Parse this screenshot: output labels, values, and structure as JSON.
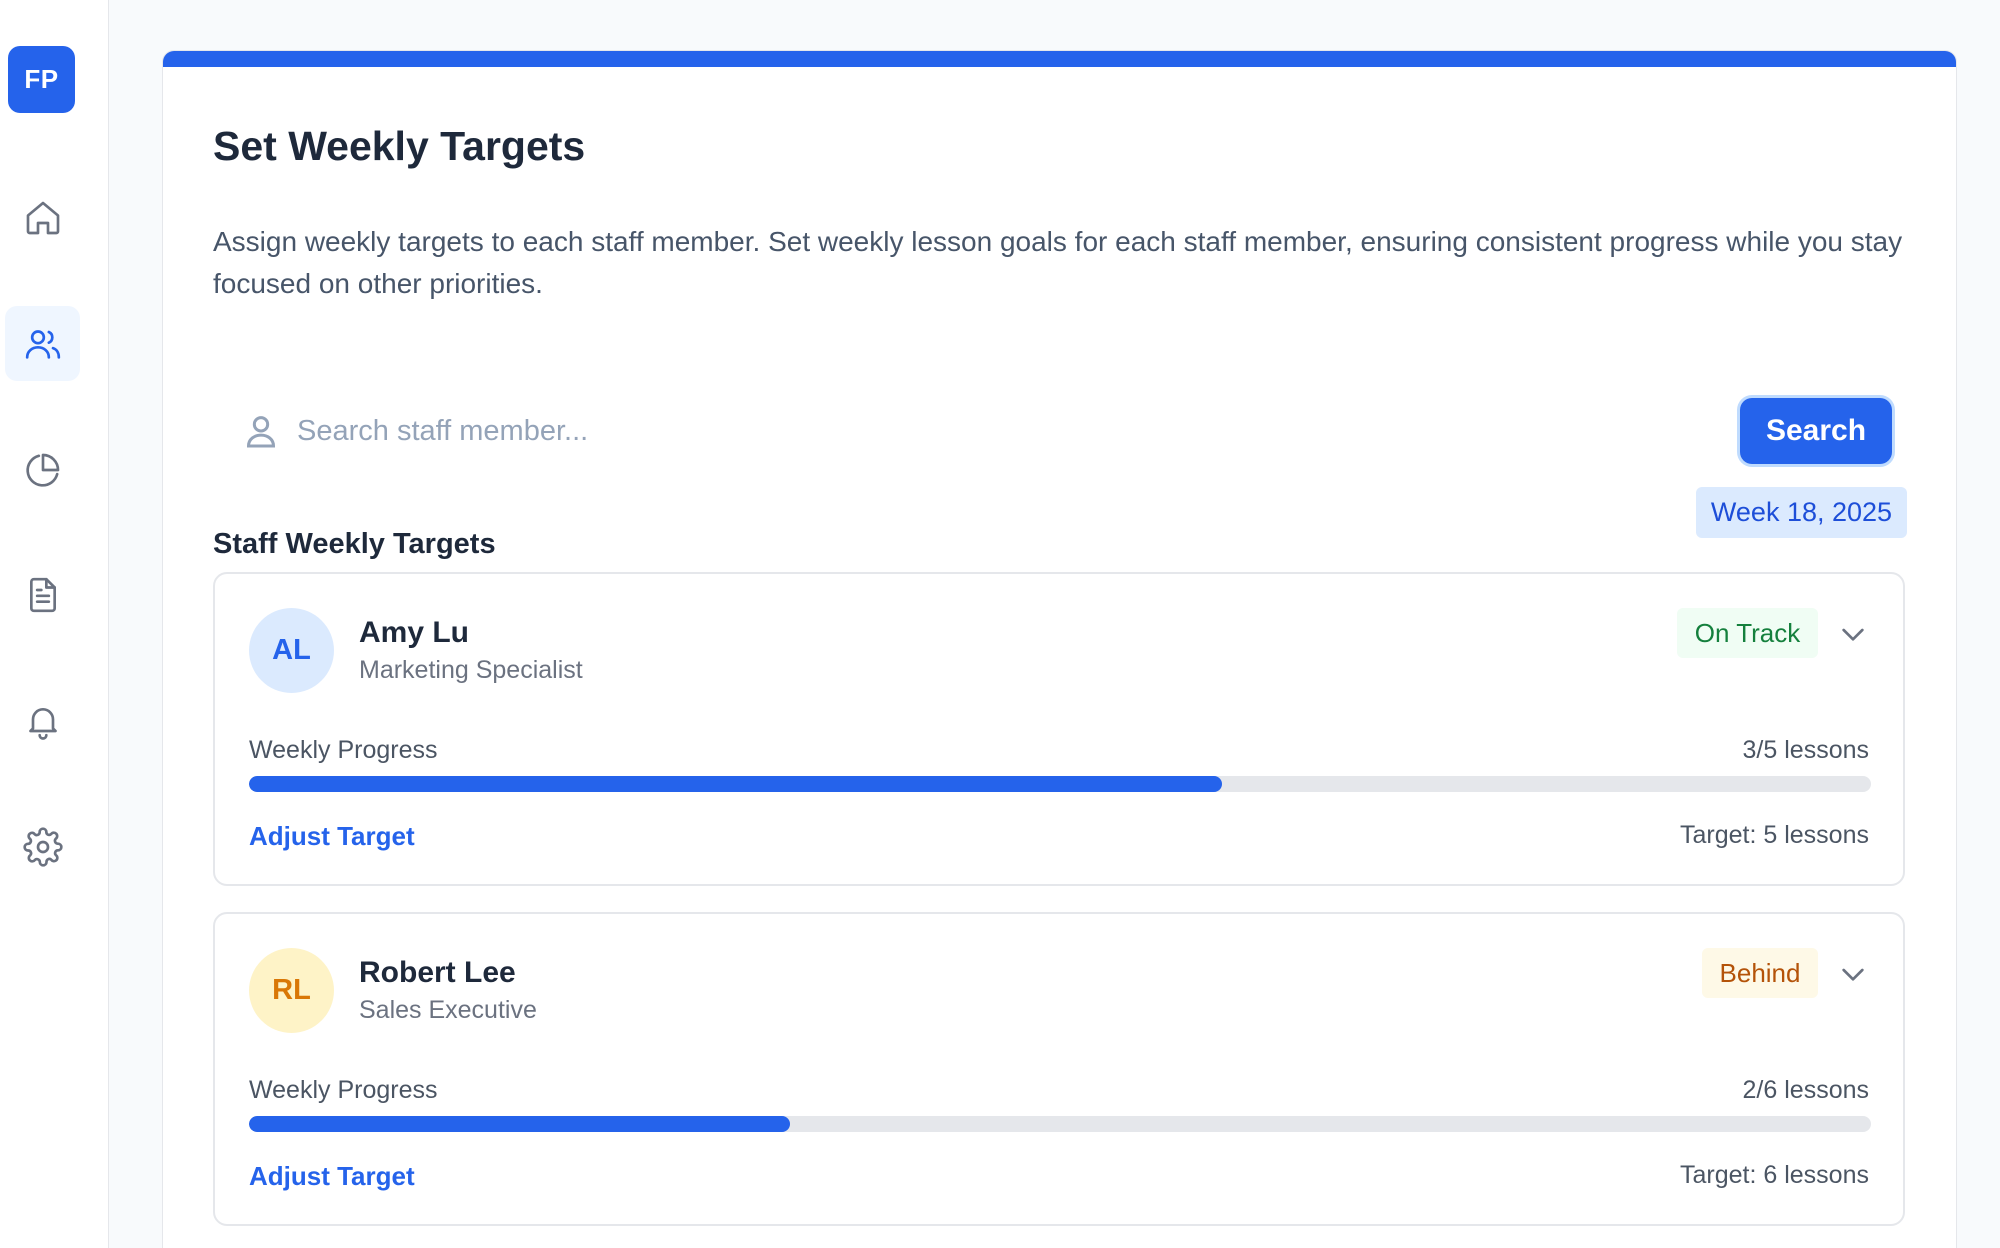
{
  "sidebar": {
    "logo": "FP",
    "items": [
      {
        "icon": "home-icon"
      },
      {
        "icon": "users-icon",
        "active": true
      },
      {
        "icon": "pie-chart-icon"
      },
      {
        "icon": "document-icon"
      },
      {
        "icon": "bell-icon"
      },
      {
        "icon": "gear-icon"
      }
    ]
  },
  "page": {
    "title": "Set Weekly Targets",
    "description": "Assign weekly targets to each staff member. Set weekly lesson goals for each staff member, ensuring consistent progress while you stay focused on other priorities."
  },
  "search": {
    "placeholder": "Search staff member...",
    "value": "",
    "button_label": "Search"
  },
  "section": {
    "title": "Staff Weekly Targets",
    "week_badge": "Week 18, 2025"
  },
  "staff": [
    {
      "initials": "AL",
      "name": "Amy Lu",
      "role": "Marketing Specialist",
      "status": "On Track",
      "progress_label": "Weekly Progress",
      "progress_text": "3/5 lessons",
      "completed": 3,
      "target": 5,
      "adjust_label": "Adjust Target",
      "target_text": "Target: 5 lessons"
    },
    {
      "initials": "RL",
      "name": "Robert Lee",
      "role": "Sales Executive",
      "status": "Behind",
      "progress_label": "Weekly Progress",
      "progress_text": "2/6 lessons",
      "completed": 2,
      "target": 6,
      "adjust_label": "Adjust Target",
      "target_text": "Target: 6 lessons"
    }
  ],
  "colors": {
    "accent": "#2563eb",
    "on_track_bg": "#f0fdf4",
    "on_track_text": "#15803d",
    "behind_bg": "#fef9e7",
    "behind_text": "#b45309",
    "avatar_blue_bg": "#dbeafe",
    "avatar_blue_text": "#2563eb",
    "avatar_yellow_bg": "#fef3c7",
    "avatar_yellow_text": "#d97706"
  }
}
